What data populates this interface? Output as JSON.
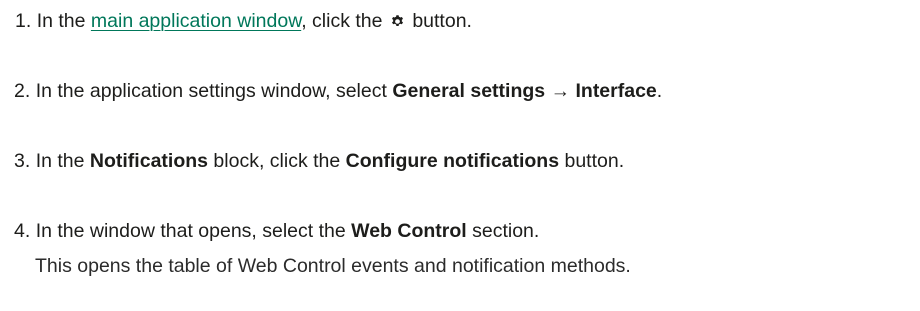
{
  "steps": [
    {
      "number": "1.",
      "text_before": "In the",
      "link": "main application window",
      "text_mid": ", click the",
      "icon": "gear-icon",
      "text_after": "button."
    },
    {
      "number": "2.",
      "text_before": "In the application settings window, select",
      "bold_1": "General settings",
      "arrow": "→",
      "bold_2": "Interface",
      "text_after": "."
    },
    {
      "number": "3.",
      "text_before": "In the",
      "bold_1": "Notifications",
      "text_mid": "block, click the",
      "bold_2": "Configure notifications",
      "text_after": "button."
    },
    {
      "number": "4.",
      "text_before": "In the window that opens, select the",
      "bold_1": "Web Control",
      "text_after": "section."
    }
  ],
  "note": "This opens the table of Web Control events and notification methods.",
  "colors": {
    "link": "#00775a",
    "text": "#1d1d1b"
  }
}
